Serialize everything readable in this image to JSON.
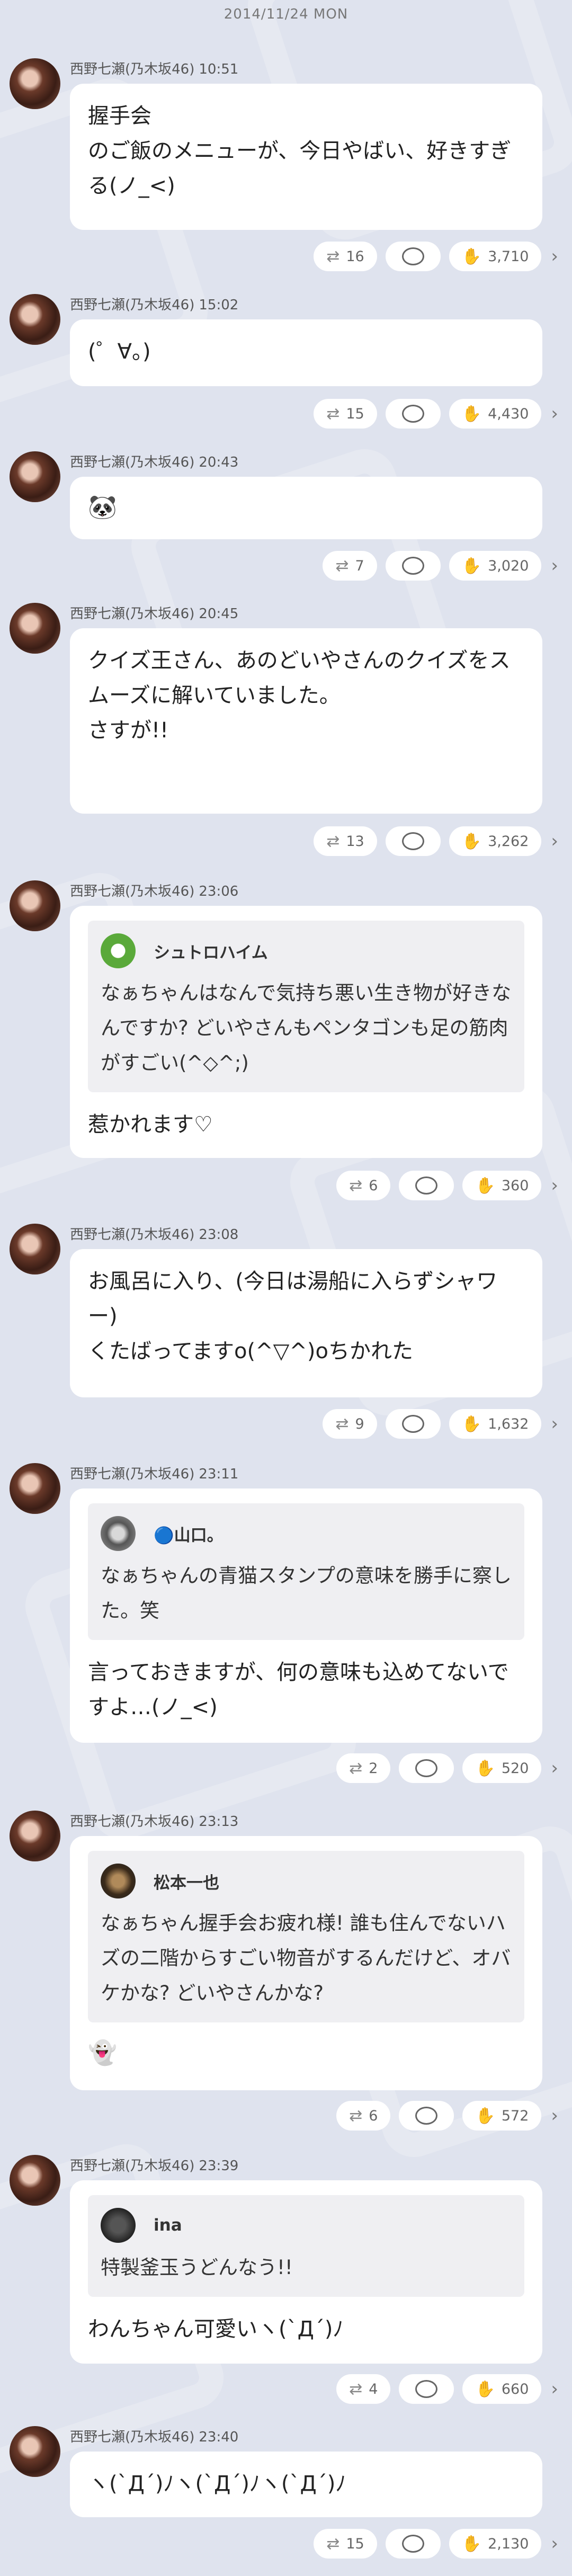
{
  "date_header": "2014/11/24 MON",
  "posts": [
    {
      "author": "西野七瀬(乃木坂46)",
      "time": "10:51",
      "text": "握手会\nのご飯のメニューが、今日やばい、好きすぎる(ノ_<)",
      "retweets": "16",
      "likes": "3,710"
    },
    {
      "author": "西野七瀬(乃木坂46)",
      "time": "15:02",
      "text": "(゜∀。)",
      "retweets": "15",
      "likes": "4,430"
    },
    {
      "author": "西野七瀬(乃木坂46)",
      "time": "20:43",
      "text": "🐼",
      "retweets": "7",
      "likes": "3,020"
    },
    {
      "author": "西野七瀬(乃木坂46)",
      "time": "20:45",
      "text": "クイズ王さん、あのどいやさんのクイズをスムーズに解いていました。\nさすが!!",
      "retweets": "13",
      "likes": "3,262"
    },
    {
      "author": "西野七瀬(乃木坂46)",
      "time": "23:06",
      "quote_name": "シュトロハイム",
      "quote_text": "なぁちゃんはなんで気持ち悪い生き物が好きなんですか? どいやさんもペンタゴンも足の筋肉がすごい(^◇^;)",
      "text": "惹かれます♡",
      "retweets": "6",
      "likes": "360"
    },
    {
      "author": "西野七瀬(乃木坂46)",
      "time": "23:08",
      "text": "お風呂に入り、(今日は湯船に入らずシャワー)\nくたばってますo(^▽^)oちかれた",
      "retweets": "9",
      "likes": "1,632"
    },
    {
      "author": "西野七瀬(乃木坂46)",
      "time": "23:11",
      "quote_name": "🔵山口。",
      "quote_text": "なぁちゃんの青猫スタンプの意味を勝手に察した。笑",
      "text": "言っておきますが、何の意味も込めてないですよ…(ノ_<)",
      "retweets": "2",
      "likes": "520"
    },
    {
      "author": "西野七瀬(乃木坂46)",
      "time": "23:13",
      "quote_name": "松本一也",
      "quote_text": "なぁちゃん握手会お疲れ様! 誰も住んでないハズの二階からすごい物音がするんだけど、オバケかな? どいやさんかな?",
      "text": "👻",
      "retweets": "6",
      "likes": "572"
    },
    {
      "author": "西野七瀬(乃木坂46)",
      "time": "23:39",
      "quote_name": "ina",
      "quote_text": "特製釜玉うどんなう!!",
      "text": "わんちゃん可愛いヽ(`Д´)ﾉ",
      "retweets": "4",
      "likes": "660"
    },
    {
      "author": "西野七瀬(乃木坂46)",
      "time": "23:40",
      "text": "ヽ(`Д´)ﾉヽ(`Д´)ﾉヽ(`Д´)ﾉ",
      "retweets": "15",
      "likes": "2,130"
    }
  ]
}
